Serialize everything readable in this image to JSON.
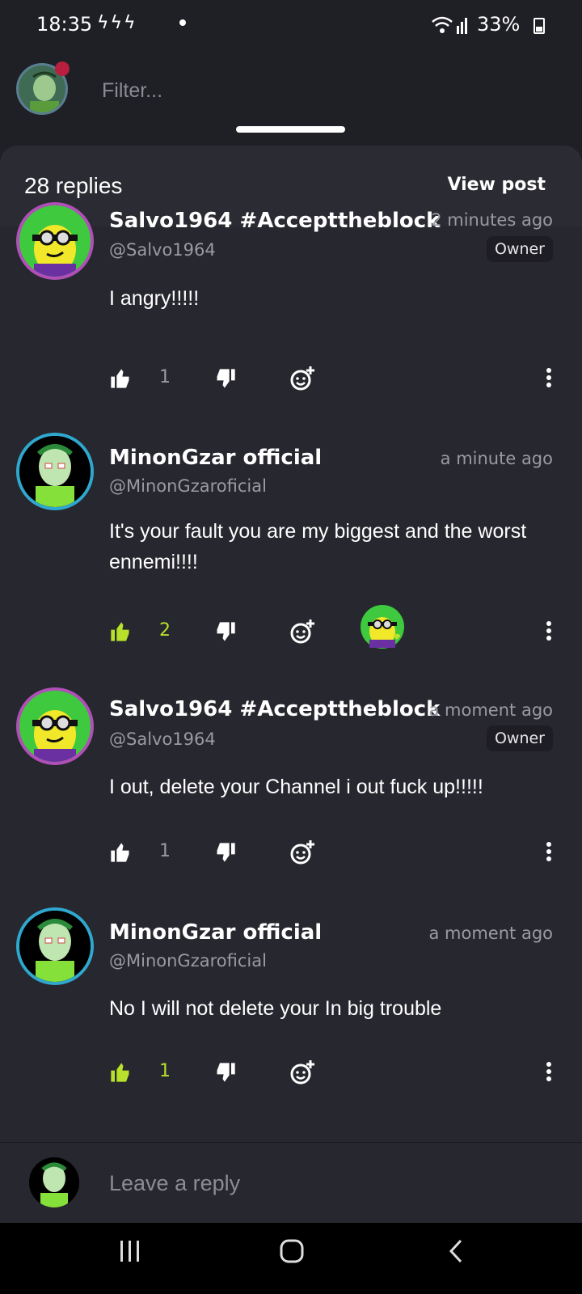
{
  "status_bar": {
    "time": "18:35",
    "bolts": "ϟϟϟ",
    "battery": "33%"
  },
  "header": {
    "filter_placeholder": "Filter..."
  },
  "sheet": {
    "replies_count": "28 replies",
    "view_post_label": "View post"
  },
  "comments": [
    {
      "name": "Salvo1964  #Accepttheblock",
      "handle": "@Salvo1964",
      "time": "2 minutes ago",
      "badge": "Owner",
      "text": "I angry!!!!!",
      "likes": "1"
    },
    {
      "name": "MinonGzar official",
      "handle": "@MinonGzaroficial",
      "time": "a minute ago",
      "text": "It's your fault you are my biggest and the worst ennemi!!!!",
      "likes": "2"
    },
    {
      "name": "Salvo1964  #Accepttheblock",
      "handle": "@Salvo1964",
      "time": "a moment ago",
      "badge": "Owner",
      "text": "I out, delete your Channel i out fuck up!!!!!",
      "likes": "1"
    },
    {
      "name": "MinonGzar official",
      "handle": "@MinonGzaroficial",
      "time": "a moment ago",
      "text": "No I will not delete your In big trouble",
      "likes": "1"
    }
  ],
  "reply_bar": {
    "placeholder": "Leave a reply"
  },
  "colors": {
    "accent_like": "#b7e12a",
    "background": "#1f1f26",
    "sheet": "#27272f"
  }
}
